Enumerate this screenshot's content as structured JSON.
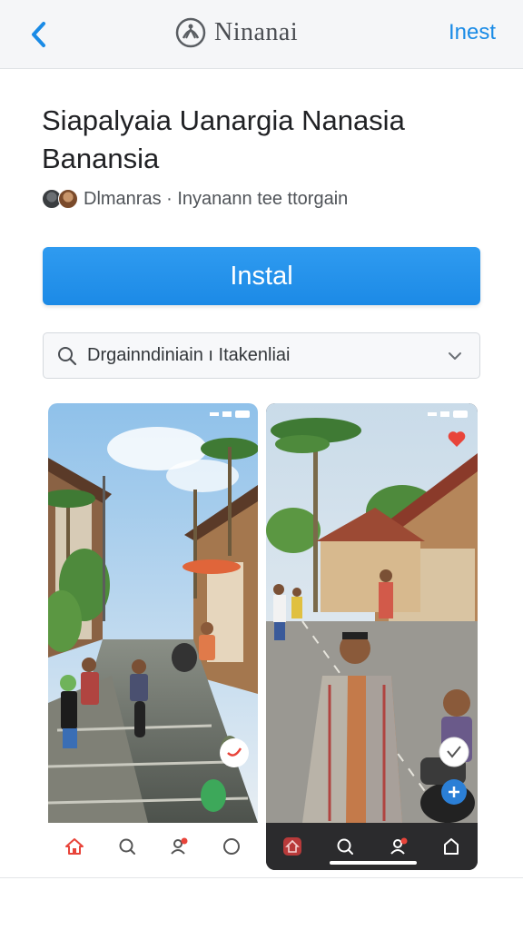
{
  "nav": {
    "back_icon": "chevron-left-icon",
    "brand_title": "Ninanai",
    "brand_icon": "emblem-logo-icon",
    "action_label": "Inest"
  },
  "app": {
    "title": "Siapalyaia Uanargia Nanasia Banansia",
    "meta_text": "Dlmanras · Inyanann tee ttorgain"
  },
  "install": {
    "label": "Instal"
  },
  "search": {
    "icon": "search-icon",
    "value": "Drgainndiniain ı Itakenliai",
    "chevron_icon": "chevron-down-icon"
  },
  "screenshots": [
    {
      "tabs": [
        "home-icon",
        "search-icon",
        "notifications-icon",
        "profile-icon"
      ]
    },
    {
      "tabs": [
        "home-icon",
        "search-icon",
        "user-icon",
        "bag-icon"
      ]
    }
  ],
  "colors": {
    "accent": "#1a8be6",
    "install_bg": "#2394ec",
    "nav_bg": "#f5f6f8",
    "badge_red": "#e8443a"
  }
}
